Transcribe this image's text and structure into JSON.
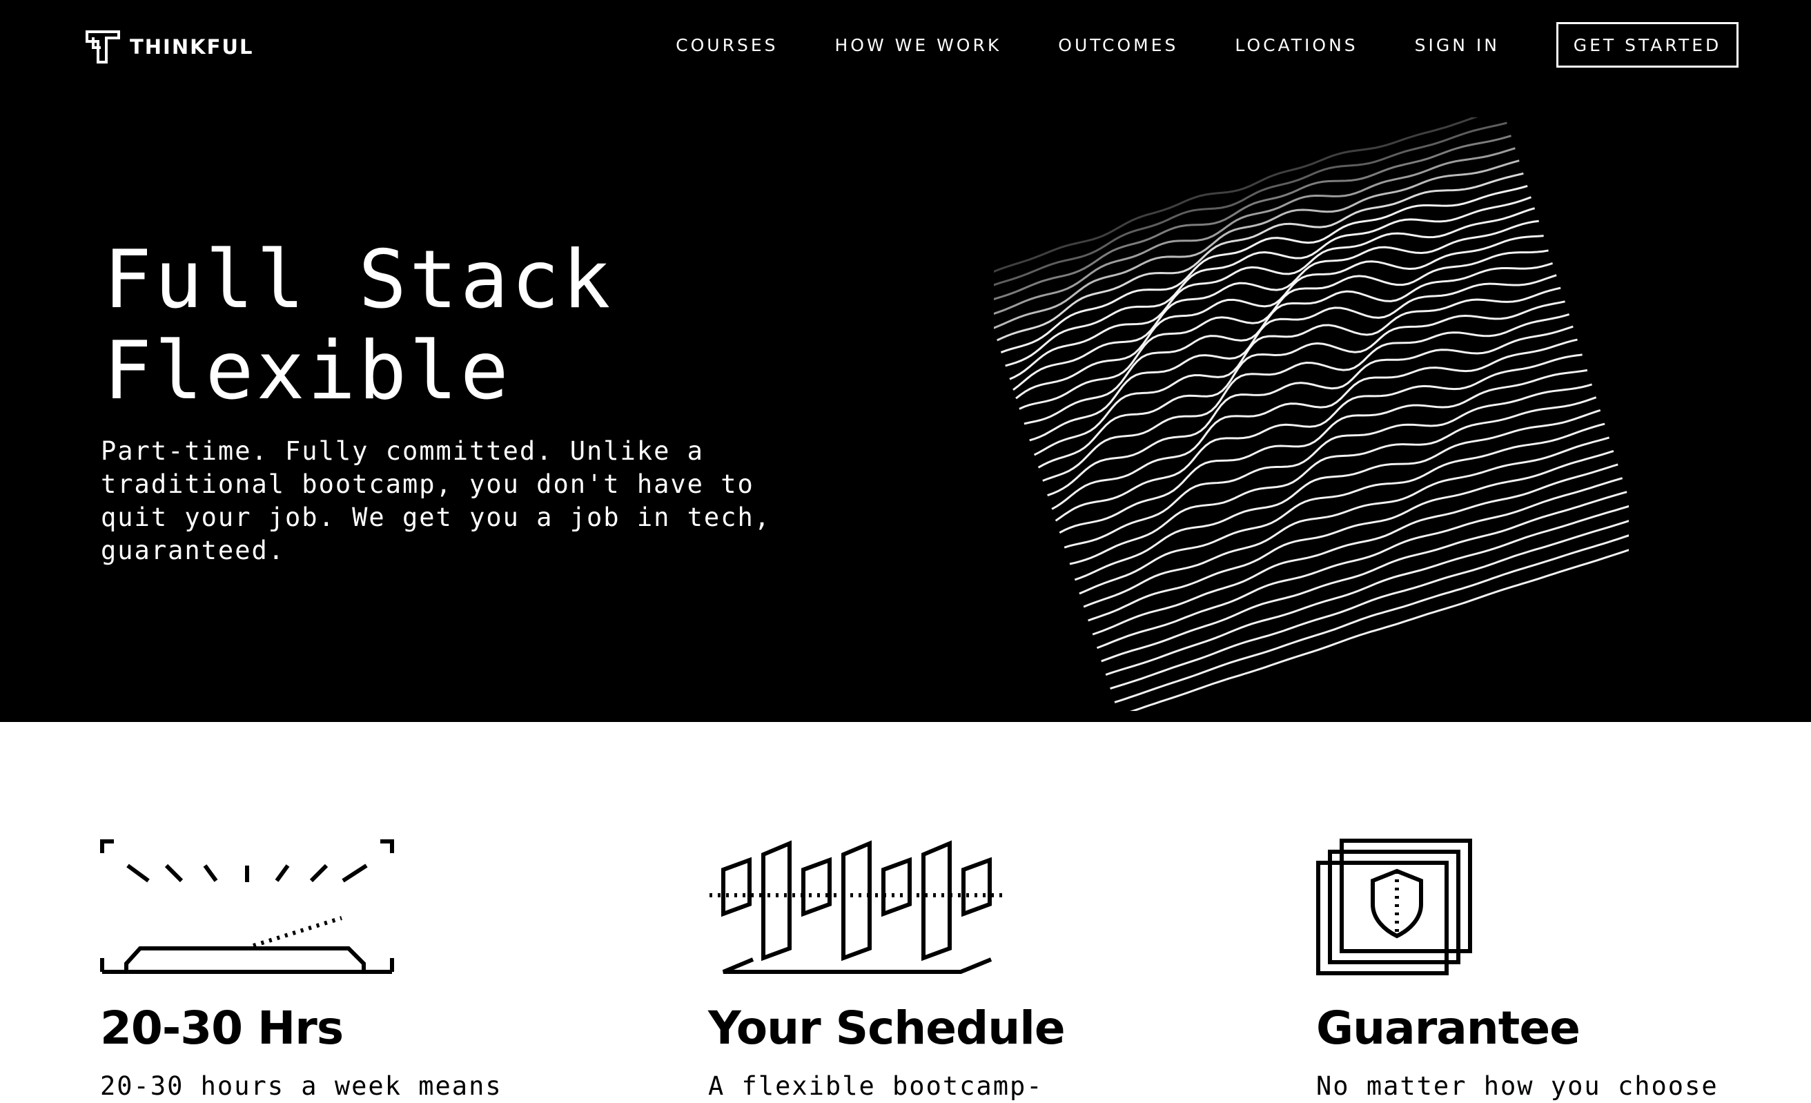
{
  "brand": {
    "name": "THINKFUL",
    "logo_icon": "thinkful-t-icon"
  },
  "nav": {
    "links": [
      "COURSES",
      "HOW WE WORK",
      "OUTCOMES",
      "LOCATIONS",
      "SIGN IN"
    ],
    "cta": "GET STARTED"
  },
  "hero": {
    "title_line1": "Full Stack",
    "title_line2": "Flexible",
    "subtitle": "Part-time. Fully committed. Unlike a traditional bootcamp, you don't have to quit your job. We get you a job in tech, guaranteed.",
    "subtitle_lines": [
      "Part-time. Fully committed. Unlike a",
      "traditional bootcamp, you don't have to",
      "quit your job. We get you a job in tech,",
      "guaranteed."
    ],
    "art_icon": "wave-lines-illustration"
  },
  "features": [
    {
      "icon": "sunrise-desk-icon",
      "title": "20-30 Hrs",
      "text": "20-30 hours a week means"
    },
    {
      "icon": "calendar-bars-icon",
      "title": "Your Schedule",
      "text": "A flexible bootcamp-"
    },
    {
      "icon": "shield-guarantee-icon",
      "title": "Guarantee",
      "text": "No matter how you choose"
    }
  ],
  "colors": {
    "hero_bg": "#000000",
    "page_bg": "#ffffff",
    "text_light": "#ffffff",
    "text_dark": "#000000"
  }
}
